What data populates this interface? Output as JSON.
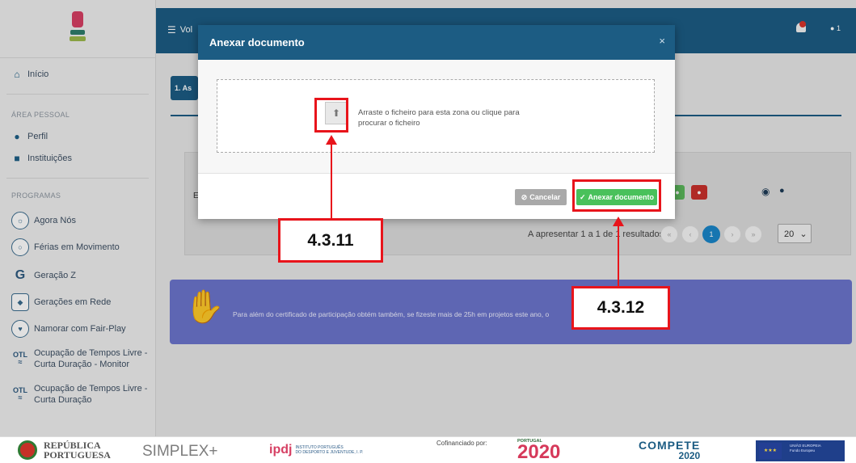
{
  "sidebar": {
    "logo_alt": "ipdj",
    "home": "Início",
    "section_personal": "ÁREA PESSOAL",
    "profile": "Perfil",
    "institutions": "Instituições",
    "section_programs": "PROGRAMAS",
    "programs": [
      {
        "label": "Agora Nós",
        "icon": "agora-nos-icon"
      },
      {
        "label": "Férias em Movimento",
        "icon": "ferias-icon"
      },
      {
        "label": "Geração Z",
        "icon": "geracao-z-icon"
      },
      {
        "label": "Gerações em Rede",
        "icon": "geracoes-rede-icon"
      },
      {
        "label": "Namorar com Fair-Play",
        "icon": "fair-play-icon"
      }
    ],
    "otl_monitor_line1": "Ocupação de Tempos Livre -",
    "otl_monitor_line2": "Curta Duração - Monitor",
    "otl_line1": "Ocupação de Tempos Livre -",
    "otl_line2": "Curta Duração",
    "otl_badge": "OTL"
  },
  "topbar": {
    "menu_label": "Vol",
    "user_count": "1"
  },
  "page": {
    "step_tab": "1. As",
    "table_first_letter": "E",
    "pager_text": "A apresentar 1 a 1 de 1 resultados",
    "pager_first": "«",
    "pager_prev": "‹",
    "pager_current": "1",
    "pager_next": "›",
    "pager_last": "»",
    "page_size": "20",
    "banner_text": "Para além do certificado de participação obtém também, se fizeste mais de 25h em projetos este ano, o"
  },
  "modal": {
    "title": "Anexar documento",
    "close": "×",
    "drop_text_line1": "Arraste o ficheiro para esta zona ou clique para",
    "drop_text_line2": "procurar o ficheiro",
    "cancel_label": "Cancelar",
    "attach_label": "Anexar documento"
  },
  "annotations": {
    "upload": "4.3.11",
    "attach": "4.3.12"
  },
  "footer": {
    "republica_line1": "REPÚBLICA",
    "republica_line2": "PORTUGUESA",
    "simplex": "SIMPLEX+",
    "ipdj_text_line1": "INSTITUTO PORTUGUÊS",
    "ipdj_text_line2": "DO DESPORTO E JUVENTUDE, I. P.",
    "cofinanciado": "Cofinanciado por:",
    "portugal_small": "PORTUGAL",
    "portugal_big": "2020",
    "compete_a": "COMPETE",
    "compete_b": "2020",
    "eu_line1": "UNIÃO EUROPEIA",
    "eu_line2": "Fundo Europeu"
  },
  "colors": {
    "primary": "#1c5c83",
    "success": "#49c15b",
    "annotation": "#e8141b",
    "banner": "#6b75cc"
  }
}
